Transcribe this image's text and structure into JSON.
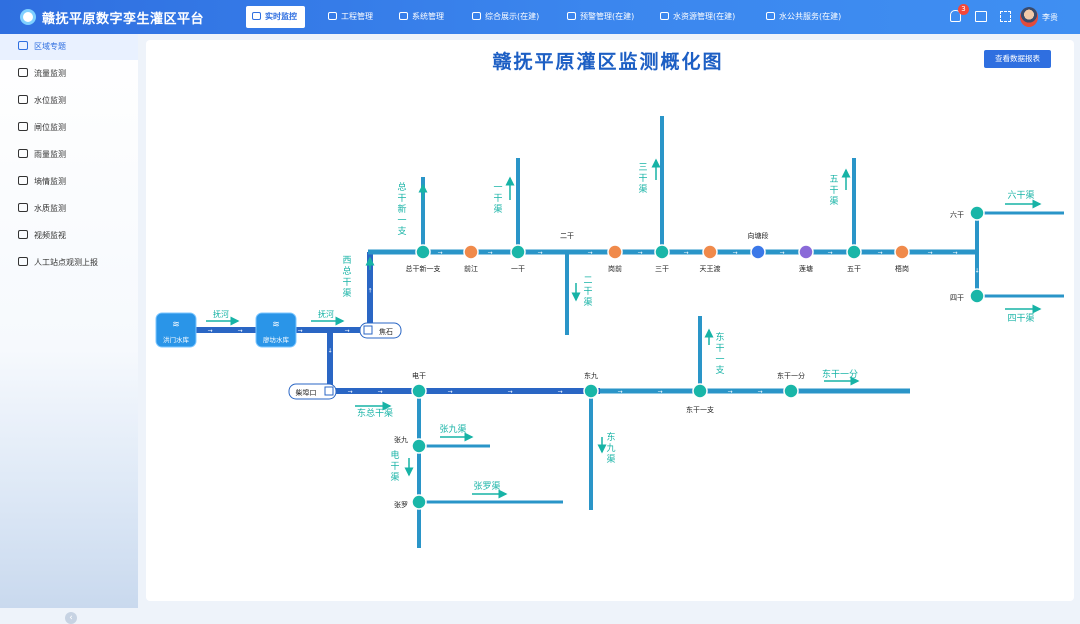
{
  "header": {
    "app_title": "赣抚平原数字孪生灌区平台",
    "nav": [
      {
        "label": "实时监控",
        "icon": "monitor-icon",
        "active": true
      },
      {
        "label": "工程管理",
        "icon": "clipboard-icon",
        "active": false
      },
      {
        "label": "系统管理",
        "icon": "gear-icon",
        "active": false
      },
      {
        "label": "综合展示(在建)",
        "icon": "cube-icon",
        "active": false
      },
      {
        "label": "预警管理(在建)",
        "icon": "grid-icon",
        "active": false
      },
      {
        "label": "水资源管理(在建)",
        "icon": "screen-icon",
        "active": false
      },
      {
        "label": "水公共服务(在建)",
        "icon": "hand-water-icon",
        "active": false
      }
    ],
    "notification_count": "3",
    "user_name": "李贵"
  },
  "sidebar": {
    "items": [
      {
        "label": "区域专题",
        "icon": "region-icon",
        "active": true
      },
      {
        "label": "流量监测",
        "icon": "flow-icon",
        "active": false
      },
      {
        "label": "水位监测",
        "icon": "water-level-icon",
        "active": false
      },
      {
        "label": "闸位监测",
        "icon": "gate-icon",
        "active": false
      },
      {
        "label": "雨量监测",
        "icon": "rain-icon",
        "active": false
      },
      {
        "label": "墒情监测",
        "icon": "soil-icon",
        "active": false
      },
      {
        "label": "水质监测",
        "icon": "water-drop-icon",
        "active": false
      },
      {
        "label": "视频监视",
        "icon": "camera-icon",
        "active": false
      },
      {
        "label": "人工站点观测上报",
        "icon": "report-icon",
        "active": false
      }
    ],
    "collapse_icon": "chevron-left-icon"
  },
  "main": {
    "title": "赣抚平原灌区监测概化图",
    "report_button": "查看数据报表"
  },
  "diagram": {
    "colors": {
      "trunk": "#2a66c4",
      "canal": "#2a95c8",
      "channel_label": "#17b3a6",
      "node": "#19b6a8",
      "station": "#f08a4b"
    },
    "reservoirs": [
      "洪门水库",
      "廖坊水库"
    ],
    "river_labels": [
      "抚河",
      "抚河"
    ],
    "gates": [
      "焦石",
      "柴埠口"
    ],
    "north_nodes": [
      "总干新一支",
      "前江",
      "一干",
      "二干",
      "岗前",
      "三干",
      "天王渡",
      "向塘段",
      "莲塘",
      "五干",
      "梧岗"
    ],
    "east_nodes": [
      "六干",
      "四干"
    ],
    "south_nodes": [
      "电干",
      "东九",
      "东干一支",
      "东干一分"
    ],
    "branch_nodes": [
      "张九",
      "张罗"
    ],
    "canal_labels": [
      "西总干渠",
      "总干新一支",
      "一干渠",
      "二干渠",
      "三干渠",
      "五干渠",
      "六干渠",
      "四干渠",
      "东总干渠",
      "东干一支",
      "东干一分",
      "张九渠",
      "电干渠",
      "张罗渠",
      "东九渠"
    ]
  }
}
